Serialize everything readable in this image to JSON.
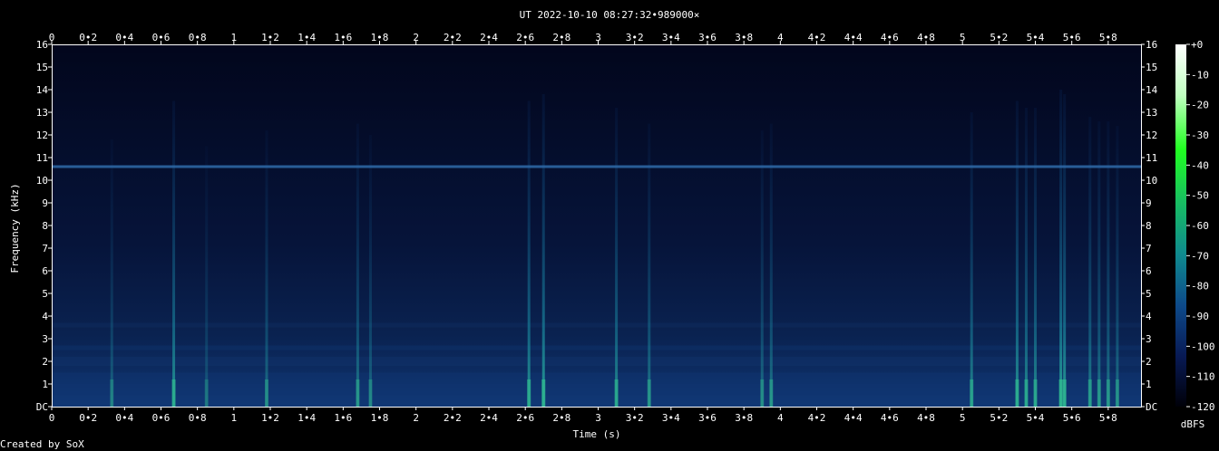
{
  "chart_data": {
    "type": "heatmap",
    "title": "UT 2022-10-10 08:27:32•989000×",
    "xlabel": "Time (s)",
    "ylabel": "Frequency (kHz)",
    "xlim": [
      0,
      5.98
    ],
    "ylim": [
      0,
      16
    ],
    "x_ticks": [
      "0",
      "0•2",
      "0•4",
      "0•6",
      "0•8",
      "1",
      "1•2",
      "1•4",
      "1•6",
      "1•8",
      "2",
      "2•2",
      "2•4",
      "2•6",
      "2•8",
      "3",
      "3•2",
      "3•4",
      "3•6",
      "3•8",
      "4",
      "4•2",
      "4•4",
      "4•6",
      "4•8",
      "5",
      "5•2",
      "5•4",
      "5•6",
      "5•8"
    ],
    "x_tick_values": [
      0,
      0.2,
      0.4,
      0.6,
      0.8,
      1,
      1.2,
      1.4,
      1.6,
      1.8,
      2,
      2.2,
      2.4,
      2.6,
      2.8,
      3,
      3.2,
      3.4,
      3.6,
      3.8,
      4,
      4.2,
      4.4,
      4.6,
      4.8,
      5,
      5.2,
      5.4,
      5.6,
      5.8
    ],
    "y_ticks": [
      "DC",
      "1",
      "2",
      "3",
      "4",
      "5",
      "6",
      "7",
      "8",
      "9",
      "10",
      "11",
      "12",
      "13",
      "14",
      "15",
      "16"
    ],
    "y_tick_values": [
      0,
      1,
      2,
      3,
      4,
      5,
      6,
      7,
      8,
      9,
      10,
      11,
      12,
      13,
      14,
      15,
      16
    ],
    "colorbar": {
      "unit": "dBFS",
      "ticks": [
        "+0",
        "-10",
        "-20",
        "-30",
        "-40",
        "-50",
        "-60",
        "-70",
        "-80",
        "-90",
        "-100",
        "-110",
        "-120"
      ],
      "tick_values": [
        0,
        -10,
        -20,
        -30,
        -40,
        -50,
        -60,
        -70,
        -80,
        -90,
        -100,
        -110,
        -120
      ],
      "colors": [
        "#000008",
        "#081a55",
        "#0d4a8a",
        "#0f8a8f",
        "#18c060",
        "#20ff20",
        "#c0ffc0",
        "#ffffff"
      ]
    },
    "features": {
      "tone_khz": 10.6,
      "noise_floor_dbfs": -105,
      "impulses": [
        {
          "t": 0.67,
          "level": -75
        },
        {
          "t": 0.33,
          "level": -92
        },
        {
          "t": 0.85,
          "level": -95
        },
        {
          "t": 1.18,
          "level": -88
        },
        {
          "t": 1.68,
          "level": -85
        },
        {
          "t": 1.75,
          "level": -90
        },
        {
          "t": 2.62,
          "level": -75
        },
        {
          "t": 2.7,
          "level": -72
        },
        {
          "t": 3.1,
          "level": -78
        },
        {
          "t": 3.28,
          "level": -85
        },
        {
          "t": 3.9,
          "level": -88
        },
        {
          "t": 3.95,
          "level": -85
        },
        {
          "t": 5.05,
          "level": -80
        },
        {
          "t": 5.3,
          "level": -75
        },
        {
          "t": 5.35,
          "level": -78
        },
        {
          "t": 5.4,
          "level": -78
        },
        {
          "t": 5.54,
          "level": -70
        },
        {
          "t": 5.56,
          "level": -72
        },
        {
          "t": 5.7,
          "level": -82
        },
        {
          "t": 5.75,
          "level": -84
        },
        {
          "t": 5.8,
          "level": -84
        },
        {
          "t": 5.85,
          "level": -86
        }
      ]
    }
  },
  "footer": {
    "credit": "Created by SoX"
  }
}
